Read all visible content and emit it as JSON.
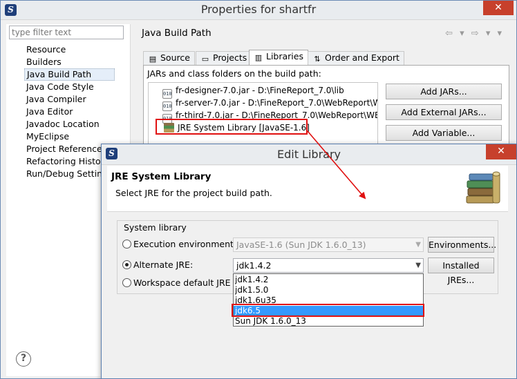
{
  "main_window": {
    "title": "Properties for shartfr",
    "close_glyph": "✕",
    "filter_placeholder": "type filter text",
    "nav_items": [
      {
        "label": "Resource"
      },
      {
        "label": "Builders"
      },
      {
        "label": "Java Build Path",
        "selected": true
      },
      {
        "label": "Java Code Style"
      },
      {
        "label": "Java Compiler"
      },
      {
        "label": "Java Editor"
      },
      {
        "label": "Javadoc Location"
      },
      {
        "label": "MyEclipse"
      },
      {
        "label": "Project References"
      },
      {
        "label": "Refactoring History"
      },
      {
        "label": "Run/Debug Settings"
      }
    ],
    "page_title": "Java Build Path",
    "nav_arrows": "⇦ ▾ ⇨ ▾ ▾",
    "tabs": [
      {
        "label": "Source",
        "icon": "source-folder-icon"
      },
      {
        "label": "Projects",
        "icon": "projects-icon"
      },
      {
        "label": "Libraries",
        "icon": "libraries-icon",
        "active": true
      },
      {
        "label": "Order and Export",
        "icon": "order-export-icon"
      }
    ],
    "libraries_heading": "JARs and class folders on the build path:",
    "jar_entries": [
      "fr-designer-7.0.jar - D:\\FineReport_7.0\\lib",
      "fr-server-7.0.jar - D:\\FineReport_7.0\\WebReport\\W",
      "fr-third-7.0.jar - D:\\FineReport_7.0\\WebReport\\WE"
    ],
    "jre_library": "JRE System Library [JavaSE-1.6]",
    "buttons": {
      "add_jars": "Add JARs...",
      "add_external_jars": "Add External JARs...",
      "add_variable": "Add Variable..."
    },
    "help_glyph": "?",
    "app_icon_glyph": "S"
  },
  "edit_dialog": {
    "title": "Edit Library",
    "close_glyph": "✕",
    "banner_title": "JRE System Library",
    "banner_description": "Select JRE for the project build path.",
    "group_label": "System library",
    "execution_env_label": "Execution environment:",
    "execution_env_value": "JavaSE-1.6 (Sun JDK 1.6.0_13)",
    "environments_button": "Environments...",
    "alternate_jre_label": "Alternate JRE:",
    "alternate_jre_value": "jdk1.4.2",
    "installed_jres_button": "Installed JREs...",
    "workspace_default_label": "Workspace default JRE (j",
    "dropdown_options": [
      {
        "label": "jdk1.4.2"
      },
      {
        "label": "jdk1.5.0"
      },
      {
        "label": "jdk1.6u35"
      },
      {
        "label": "jdk6.5",
        "selected": true
      },
      {
        "label": "Sun JDK 1.6.0_13"
      }
    ],
    "selected_radio": "alternate_jre"
  },
  "colors": {
    "highlight": "#e01010",
    "selection": "#3399ff",
    "close_button": "#c7402c"
  }
}
